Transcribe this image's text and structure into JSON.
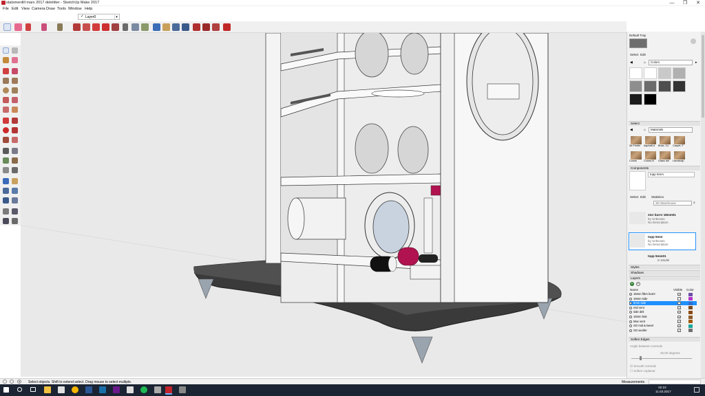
{
  "window": {
    "title": "statsmerdill mars 2017 delelitter - SketchUp Make 2017",
    "controls": [
      "—",
      "❐",
      "✕"
    ]
  },
  "menu": [
    "File",
    "Edit",
    "View",
    "Camera",
    "Draw",
    "Tools",
    "Window",
    "Help"
  ],
  "layer_dropdown": {
    "check": "✓",
    "value": "Layer0"
  },
  "tray": {
    "default_tray_title": "Default Tray",
    "materials_top": {
      "tabs": [
        "Select",
        "Edit"
      ],
      "collection": "Colors",
      "swatches": [
        "#ffffff",
        "#ffffff",
        "#c9c9c9",
        "#b0b0b0",
        "#8e8e8e",
        "#6c6c6c",
        "#4e4e4e",
        "#333333",
        "#1c1c1c",
        "#000000"
      ]
    },
    "materials_select": {
      "section": "Select",
      "collection": "Materials",
      "items": [
        "3d Printin",
        "Asphalt a",
        "Brick, Co",
        "Carpet, F",
        "Colors",
        "Colors-N",
        "Glass am",
        "Landscap"
      ]
    },
    "components": {
      "section": "Components",
      "name": "topp 5mm",
      "tabs": [
        "Select",
        "Edit",
        "Statistics"
      ],
      "search": "3D Warehouse",
      "list": [
        {
          "name": "stor burnr 18mm01",
          "author": "by Unknown",
          "desc": "No Description"
        },
        {
          "name": "topp 5mm",
          "author": "by Unknown",
          "desc": "No Description"
        },
        {
          "name": "topp 5mm01",
          "author": "",
          "desc": ""
        }
      ],
      "footer": "In Model"
    },
    "sections": {
      "styles": "Styles",
      "shadows": "Shadows",
      "layers": "Layers"
    },
    "layers": {
      "headers": [
        "Name",
        "Visible",
        "Color"
      ],
      "rows": [
        {
          "name": "16mm fibre burnr",
          "visible": true,
          "color": "#6c4ea8",
          "selected": false
        },
        {
          "name": "16mm side",
          "visible": false,
          "color": "#b333c9",
          "selected": false
        },
        {
          "name": "5mm side",
          "visible": false,
          "color": "#2f6fd1",
          "selected": true
        },
        {
          "name": "mid vent",
          "visible": true,
          "color": "#7a4b1e",
          "selected": false
        },
        {
          "name": "side deli",
          "visible": true,
          "color": "#8a4a14",
          "selected": false
        },
        {
          "name": "16mm bak",
          "visible": true,
          "color": "#8b5a2b",
          "selected": false
        },
        {
          "name": "Mac vent",
          "visible": true,
          "color": "#a05a10",
          "selected": false
        },
        {
          "name": "SO mid & tweet",
          "visible": true,
          "color": "#1aa59a",
          "selected": false
        },
        {
          "name": "SO woofer",
          "visible": true,
          "color": "#707070",
          "selected": false
        }
      ]
    },
    "soften": {
      "section": "Soften Edges",
      "label": "Angle between normals",
      "value": "20,00 degrees",
      "options": [
        "Smooth normals",
        "Soften coplanar"
      ]
    }
  },
  "status": {
    "message": "Select objects. Shift to extend select. Drag mouse to select multiple.",
    "measurements_label": "Measurements"
  },
  "taskbar": {
    "time": "02:22",
    "date": "11.03.2017"
  },
  "colors": {
    "accent_select": "#1e90ff",
    "tray_bg": "#f2f2f2",
    "model_base": "#3a3a3a",
    "speaker_red": "#b0134f"
  }
}
